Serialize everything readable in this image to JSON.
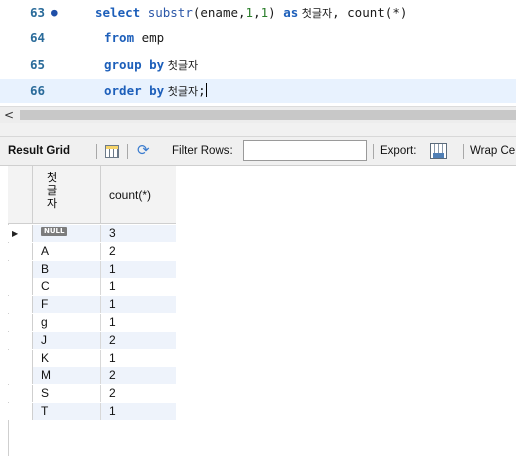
{
  "editor": {
    "lines": [
      {
        "number": "63",
        "has_bullet": true,
        "kw1": "select",
        "pre": " ",
        "fn": "substr",
        "args1": "(ename,",
        "n1": "1",
        "comma": ",",
        "n2": "1",
        "args2": ") ",
        "kw2": "as",
        "alias": " 첫글자",
        "rest": ", count(*)"
      },
      {
        "number": "64",
        "kw": "from",
        "rest": " emp"
      },
      {
        "number": "65",
        "kw": "group by",
        "alias": " 첫글자"
      },
      {
        "number": "66",
        "kw": "order by",
        "alias": " 첫글자",
        "rest": ";"
      }
    ],
    "bullet": "●",
    "active_line": 66
  },
  "scrollbar": {
    "left_arrow": "<"
  },
  "toolbar": {
    "result_grid_label": "Result Grid",
    "filter_rows_label": "Filter Rows:",
    "filter_value": "",
    "export_label": "Export:",
    "wrap_label": "Wrap Ce"
  },
  "grid": {
    "columns": [
      "첫글자",
      "count(*)"
    ],
    "column1_header_chars": [
      "첫",
      "글",
      "자"
    ],
    "null_label": "NULL",
    "rows": [
      {
        "c1": "NULL",
        "c2": "3",
        "is_null": true,
        "current": true
      },
      {
        "c1": "A",
        "c2": "2"
      },
      {
        "c1": "B",
        "c2": "1"
      },
      {
        "c1": "C",
        "c2": "1"
      },
      {
        "c1": "F",
        "c2": "1"
      },
      {
        "c1": "g",
        "c2": "1"
      },
      {
        "c1": "J",
        "c2": "2"
      },
      {
        "c1": "K",
        "c2": "1"
      },
      {
        "c1": "M",
        "c2": "2"
      },
      {
        "c1": "S",
        "c2": "2"
      },
      {
        "c1": "T",
        "c2": "1"
      }
    ],
    "row_pointer": "▶"
  },
  "colors": {
    "keyword": "#1d5fba",
    "number": "#2a7e2a",
    "line_number": "#2a6b9a",
    "active_line_bg": "#e8f2fe",
    "row_shade": "#eef3fb"
  }
}
